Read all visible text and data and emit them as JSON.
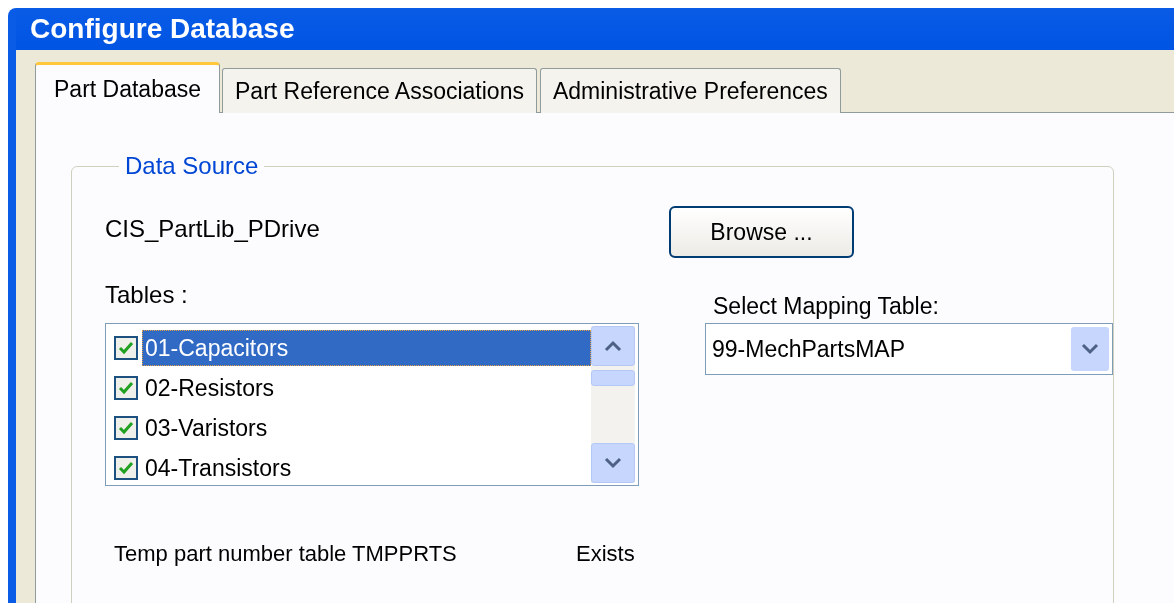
{
  "window": {
    "title": "Configure Database"
  },
  "tabs": [
    {
      "label": "Part Database",
      "selected": true
    },
    {
      "label": "Part Reference Associations",
      "selected": false
    },
    {
      "label": "Administrative Preferences",
      "selected": false
    }
  ],
  "data_source": {
    "title": "Data Source",
    "name": "CIS_PartLib_PDrive",
    "browse_button": "Browse ...",
    "tables_label": "Tables :",
    "tables": [
      {
        "label": "01-Capacitors",
        "checked": true,
        "selected": true
      },
      {
        "label": "02-Resistors",
        "checked": true,
        "selected": false
      },
      {
        "label": "03-Varistors",
        "checked": true,
        "selected": false
      },
      {
        "label": "04-Transistors",
        "checked": true,
        "selected": false
      }
    ],
    "mapping_label": "Select Mapping Table:",
    "mapping_value": "99-MechPartsMAP"
  },
  "temp_table": {
    "label": "Temp part number table TMPPRTS",
    "status": "Exists"
  }
}
